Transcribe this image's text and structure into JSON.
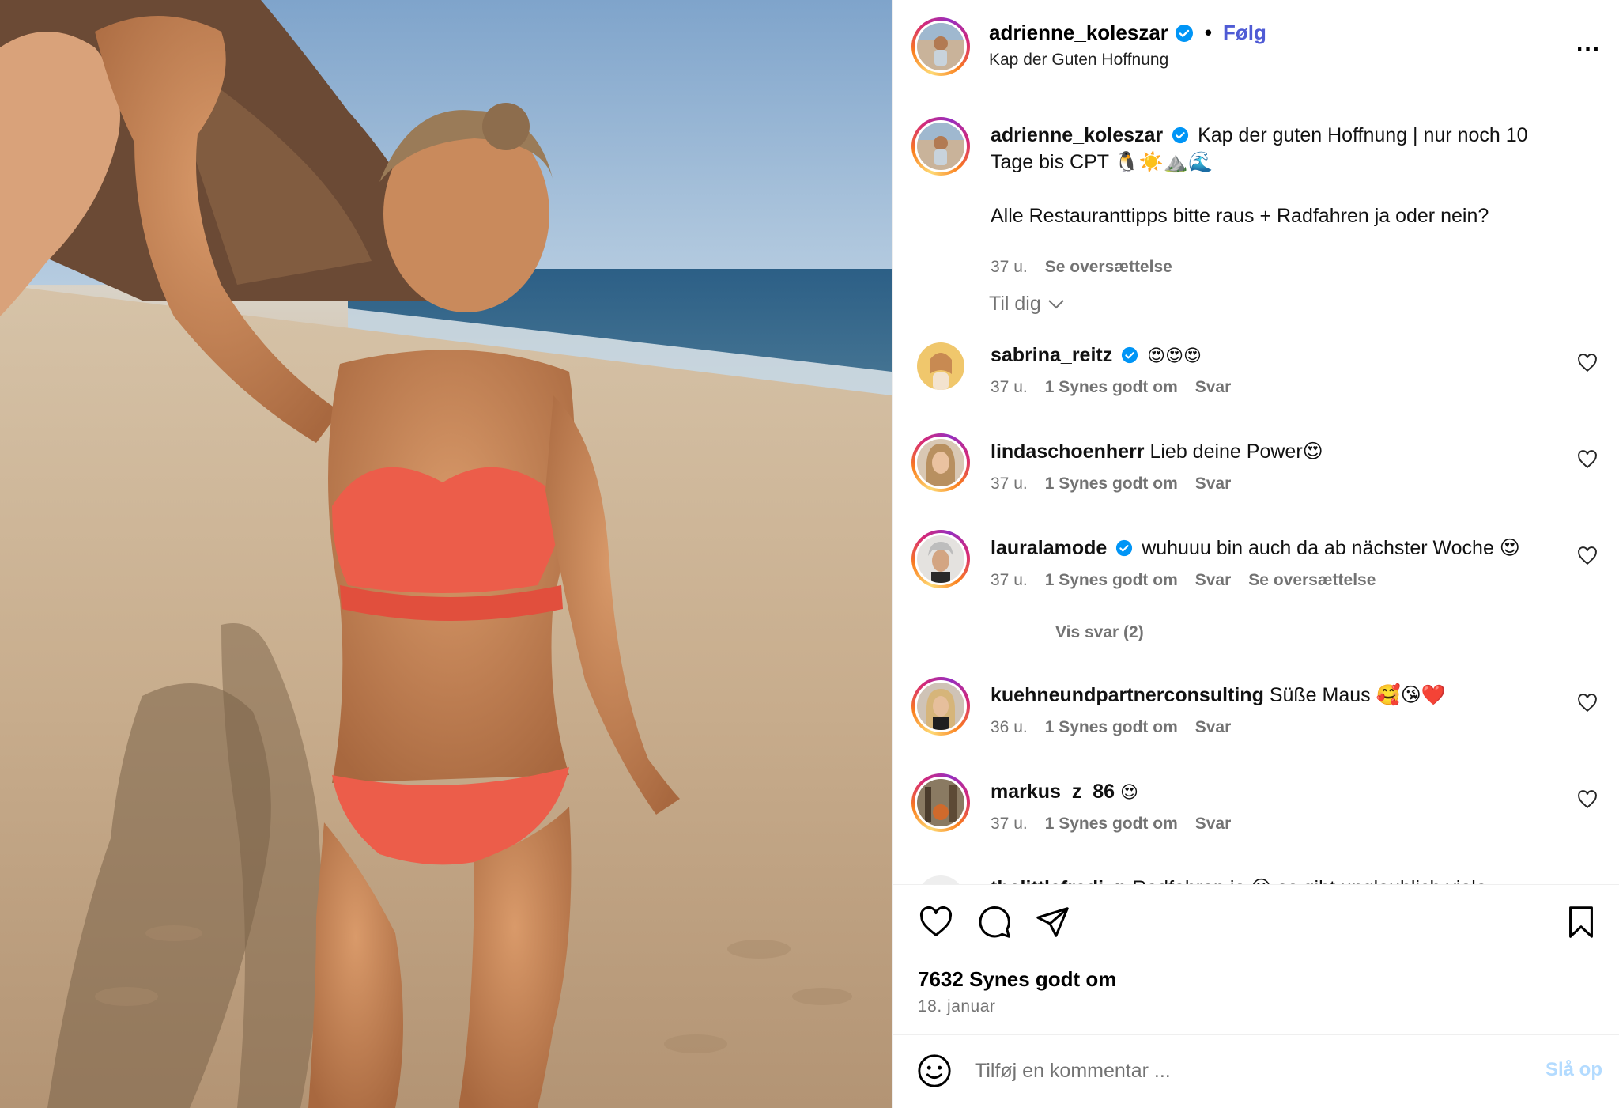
{
  "post": {
    "username": "adrienne_koleszar",
    "follow_label": "Følg",
    "separator": "•",
    "location": "Kap der Guten Hoffnung",
    "more_label": "..."
  },
  "caption": {
    "username": "adrienne_koleszar",
    "text_line1": "Kap der guten Hoffnung | nur noch 10",
    "text_line2": "Tage bis CPT 🐧☀️⛰️🌊",
    "text_line3": "Alle Restauranttipps bitte raus + Radfahren ja oder nein?",
    "time": "37 u.",
    "translate": "Se oversættelse"
  },
  "sort_label": "Til dig",
  "comments": [
    {
      "username": "sabrina_reitz",
      "verified": true,
      "text": "😍😍😍",
      "time": "37 u.",
      "likes": "1 Synes godt om",
      "reply": "Svar",
      "translate": ""
    },
    {
      "username": "lindaschoenherr",
      "verified": false,
      "text": "Lieb deine Power😍",
      "time": "37 u.",
      "likes": "1 Synes godt om",
      "reply": "Svar",
      "translate": ""
    },
    {
      "username": "lauralamode",
      "verified": true,
      "text": "wuhuuu bin auch da ab nächster Woche 😍",
      "time": "37 u.",
      "likes": "1 Synes godt om",
      "reply": "Svar",
      "translate": "Se oversættelse"
    },
    {
      "username": "kuehneundpartnerconsulting",
      "verified": false,
      "text": "Süße Maus 🥰😘❤️",
      "time": "36 u.",
      "likes": "1 Synes godt om",
      "reply": "Svar",
      "translate": ""
    },
    {
      "username": "markus_z_86",
      "verified": false,
      "text": "😍",
      "time": "37 u.",
      "likes": "1 Synes godt om",
      "reply": "Svar",
      "translate": ""
    },
    {
      "username": "thelittlefredi_n",
      "verified": false,
      "text": "Radfahren ja 😮 es gibt unglaublich viele",
      "time": "",
      "likes": "",
      "reply": "",
      "translate": ""
    }
  ],
  "view_replies": "Vis svar (2)",
  "likes_count": "7632 Synes godt om",
  "date": "18. januar",
  "add_comment": {
    "placeholder": "Tilføj en kommentar ...",
    "post_label": "Slå op"
  },
  "colors": {
    "follow": "#4f5bd5",
    "verified": "#0095f6",
    "post_disabled": "#b3dbff",
    "secondary_text": "#737373"
  },
  "icons": [
    "like-icon",
    "comment-icon",
    "share-icon",
    "bookmark-icon",
    "emoji-icon",
    "verified-icon",
    "more-icon",
    "chevron-down-icon"
  ]
}
